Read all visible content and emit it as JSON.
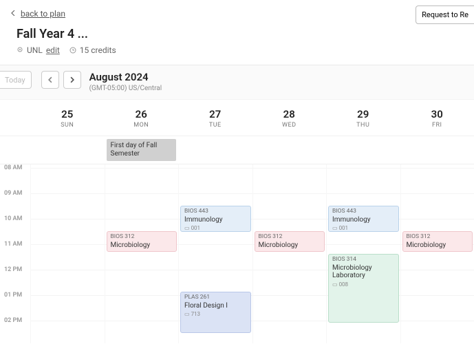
{
  "header": {
    "back_label": "back to plan",
    "title": "Fall Year 4 ...",
    "school": "UNL",
    "edit_label": "edit",
    "credits": "15 credits",
    "request_button": "Request to Re"
  },
  "toolbar": {
    "today": "Today",
    "month_title": "August 2024",
    "timezone": "(GMT-05:00) US/Central"
  },
  "days": [
    {
      "num": "25",
      "lbl": "SUN"
    },
    {
      "num": "26",
      "lbl": "MON"
    },
    {
      "num": "27",
      "lbl": "TUE"
    },
    {
      "num": "28",
      "lbl": "WED"
    },
    {
      "num": "29",
      "lbl": "THU"
    },
    {
      "num": "30",
      "lbl": "FRI"
    }
  ],
  "allday": {
    "mon": "First day of Fall Semester"
  },
  "hours": [
    "08 AM",
    "09 AM",
    "10 AM",
    "11 AM",
    "12 PM",
    "01 PM",
    "02 PM"
  ],
  "events": {
    "immu_tue": {
      "code": "BIOS 443",
      "name": "Immunology",
      "room": "001"
    },
    "immu_thu": {
      "code": "BIOS 443",
      "name": "Immunology",
      "room": "001"
    },
    "micro_mon": {
      "code": "BIOS 312",
      "name": "Microbiology"
    },
    "micro_wed": {
      "code": "BIOS 312",
      "name": "Microbiology"
    },
    "micro_fri": {
      "code": "BIOS 312",
      "name": "Microbiology"
    },
    "microlab": {
      "code": "BIOS 314",
      "name": "Microbiology Laboratory",
      "room": "008"
    },
    "floral": {
      "code": "PLAS 261",
      "name": "Floral Design I",
      "room": "713"
    }
  }
}
